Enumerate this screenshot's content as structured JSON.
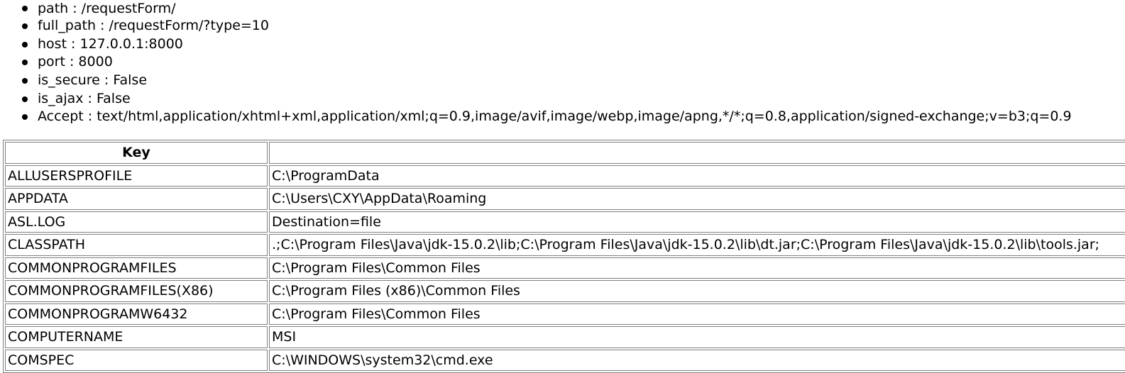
{
  "request_info": [
    {
      "label": "path : /requestForm/"
    },
    {
      "label": "full_path : /requestForm/?type=10"
    },
    {
      "label": "host : 127.0.0.1:8000"
    },
    {
      "label": "port : 8000"
    },
    {
      "label": "is_secure : False"
    },
    {
      "label": "is_ajax : False"
    },
    {
      "label": "Accept : text/html,application/xhtml+xml,application/xml;q=0.9,image/avif,image/webp,image/apng,*/*;q=0.8,application/signed-exchange;v=b3;q=0.9"
    }
  ],
  "env_table": {
    "headers": {
      "key": "Key",
      "value": ""
    },
    "rows": [
      {
        "key": "ALLUSERSPROFILE",
        "value": "C:\\ProgramData"
      },
      {
        "key": "APPDATA",
        "value": "C:\\Users\\CXY\\AppData\\Roaming"
      },
      {
        "key": "ASL.LOG",
        "value": "Destination=file"
      },
      {
        "key": "CLASSPATH",
        "value": ".;C:\\Program Files\\Java\\jdk-15.0.2\\lib;C:\\Program Files\\Java\\jdk-15.0.2\\lib\\dt.jar;C:\\Program Files\\Java\\jdk-15.0.2\\lib\\tools.jar;"
      },
      {
        "key": "COMMONPROGRAMFILES",
        "value": "C:\\Program Files\\Common Files"
      },
      {
        "key": "COMMONPROGRAMFILES(X86)",
        "value": "C:\\Program Files (x86)\\Common Files"
      },
      {
        "key": "COMMONPROGRAMW6432",
        "value": "C:\\Program Files\\Common Files"
      },
      {
        "key": "COMPUTERNAME",
        "value": "MSI"
      },
      {
        "key": "COMSPEC",
        "value": "C:\\WINDOWS\\system32\\cmd.exe"
      }
    ]
  }
}
